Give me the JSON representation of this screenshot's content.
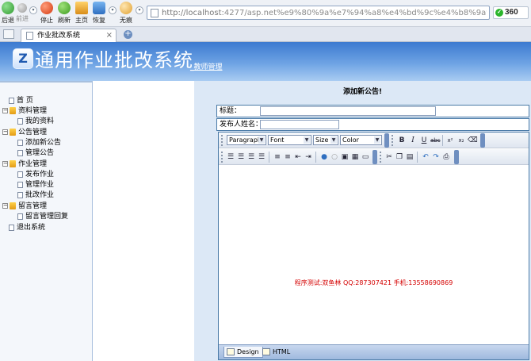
{
  "browser": {
    "nav_buttons": [
      {
        "label": "后退",
        "icon": "back-arrow-icon"
      },
      {
        "label": "前进",
        "icon": "forward-arrow-icon"
      },
      {
        "label": "停止",
        "icon": "stop-icon"
      },
      {
        "label": "刷新",
        "icon": "refresh-icon"
      },
      {
        "label": "主页",
        "icon": "home-icon"
      },
      {
        "label": "恢复",
        "icon": "restore-icon"
      },
      {
        "label": "无痕",
        "icon": "incognito-icon"
      }
    ],
    "url_host": "http://localhost",
    "url_rest": ":4277/asp.net%e9%80%9a%e7%94%a8%e4%bd%9c%e4%b8%9a%e6%89%b9%e",
    "badge": "360",
    "tab_title": "作业批改系统",
    "tab_close": "×",
    "new_tab": "+"
  },
  "header": {
    "logo_glyph": "Z",
    "title": "通用作业批改系统",
    "subtitle": "_教师管理"
  },
  "sidebar": {
    "items": [
      {
        "label": "首 页",
        "type": "page",
        "level": 0
      },
      {
        "label": "资料管理",
        "type": "folder",
        "level": 0
      },
      {
        "label": "我的资料",
        "type": "page",
        "level": 1
      },
      {
        "label": "公告管理",
        "type": "folder",
        "level": 0
      },
      {
        "label": "添加新公告",
        "type": "page",
        "level": 1
      },
      {
        "label": "管理公告",
        "type": "page",
        "level": 1
      },
      {
        "label": "作业管理",
        "type": "folder",
        "level": 0
      },
      {
        "label": "发布作业",
        "type": "page",
        "level": 1
      },
      {
        "label": "管理作业",
        "type": "page",
        "level": 1
      },
      {
        "label": "批改作业",
        "type": "page",
        "level": 1
      },
      {
        "label": "留言管理",
        "type": "folder",
        "level": 0
      },
      {
        "label": "留言管理回复",
        "type": "page",
        "level": 1
      },
      {
        "label": "退出系统",
        "type": "page",
        "level": 0
      }
    ]
  },
  "content": {
    "heading": "添加新公告!",
    "title_label": "标题：",
    "title_value": "",
    "publisher_label": "发布人姓名：",
    "publisher_value": ""
  },
  "editor": {
    "paragraph": "Paragraph",
    "font": "Font",
    "size": "Size",
    "color": "Color",
    "body_text": "程序测试:双鱼林 QQ:287307421 手机:13558690869",
    "mode_design": "Design",
    "mode_html": "HTML"
  }
}
